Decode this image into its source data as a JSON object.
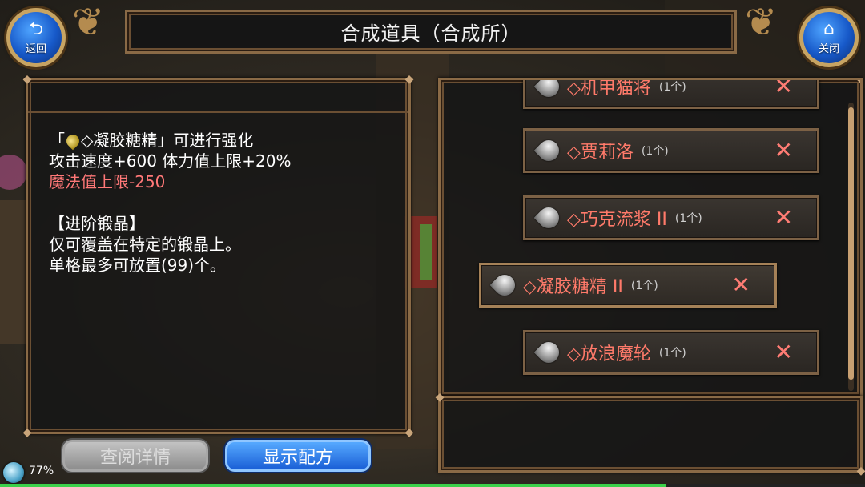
{
  "header": {
    "title": "合成道具（合成所）",
    "back_label": "返回",
    "close_label": "关闭"
  },
  "description": {
    "title_prefix": "「",
    "title_item": "◇凝胶糖精」可进行强化",
    "stat_line": "攻击速度+600 体力值上限+20%",
    "penalty_line": "魔法值上限-250",
    "section_title": "【进阶锻晶】",
    "note_line_1": "仅可覆盖在特定的锻晶上。",
    "note_line_2": "单格最多可放置(99)个。"
  },
  "buttons": {
    "detail": "查阅详情",
    "recipe": "显示配方"
  },
  "materials": [
    {
      "name": "◇机甲猫将",
      "count": "(1个)",
      "selected": false
    },
    {
      "name": "◇贾莉洛",
      "count": "(1个)",
      "selected": false
    },
    {
      "name": "◇巧克流浆 II",
      "count": "(1个)",
      "selected": false
    },
    {
      "name": "◇凝胶糖精 II",
      "count": "(1个)",
      "selected": true
    },
    {
      "name": "◇放浪魔轮",
      "count": "(1个)",
      "selected": false
    }
  ],
  "status": {
    "percent": "77%",
    "progress": 0.77
  },
  "colors": {
    "accent_red": "#ff7878",
    "frame": "#8a6a46",
    "button_blue": "#1a5fd6"
  }
}
